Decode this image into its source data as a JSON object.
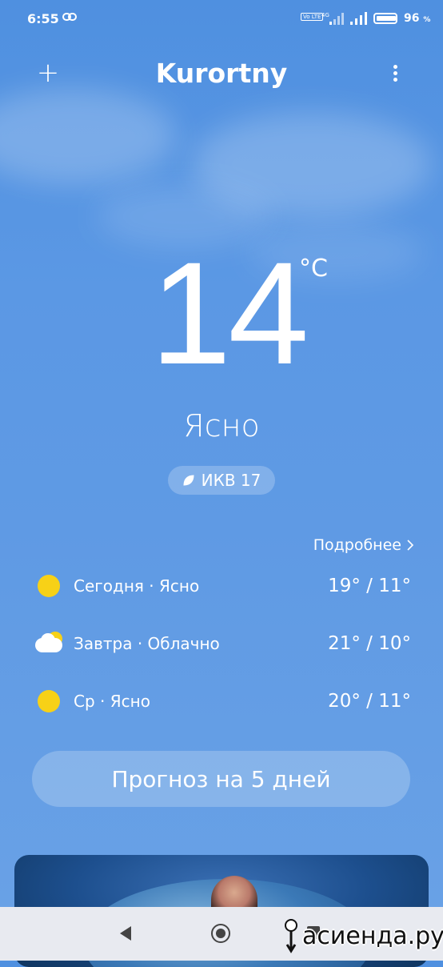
{
  "status_bar": {
    "time": "6:55",
    "volte_label": "Vo LTE",
    "network": "4G",
    "battery_percent": "96",
    "battery_unit": "%"
  },
  "header": {
    "city": "Kurortny",
    "add_icon": "plus-icon",
    "menu_icon": "more-vertical-icon"
  },
  "current": {
    "temperature": "14",
    "unit": "°C",
    "condition": "Ясно",
    "aqi_label": "ИКВ 17"
  },
  "details_link": "Подробнее",
  "daily": [
    {
      "label": "Сегодня · Ясно",
      "range": "19° / 11°",
      "icon": "sun-icon"
    },
    {
      "label": "Завтра · Облачно",
      "range": "21° / 10°",
      "icon": "partly-cloudy-icon"
    },
    {
      "label": "Ср · Ясно",
      "range": "20° / 11°",
      "icon": "sun-icon"
    }
  ],
  "forecast_button": "Прогноз на 5 дней",
  "watermark": "асиенда.ру",
  "colors": {
    "sky_top": "#4f90e0",
    "sky_bottom": "#6aa2e6",
    "sun": "#f7d117"
  }
}
